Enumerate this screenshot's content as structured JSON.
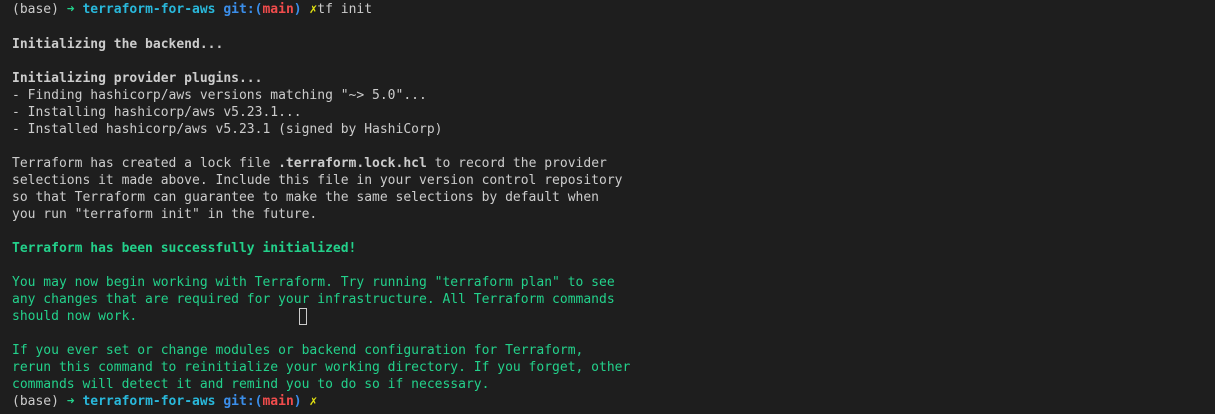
{
  "prompt1": {
    "env": "(base)",
    "arrow": "➜",
    "dir": "terraform-for-aws",
    "git_label": "git:(",
    "branch": "main",
    "git_close": ")",
    "dirty": "✗",
    "command": "tf init"
  },
  "output": {
    "backend": "Initializing the backend...",
    "plugins": "Initializing provider plugins...",
    "finding": "- Finding hashicorp/aws versions matching \"~> 5.0\"...",
    "installing": "- Installing hashicorp/aws v5.23.1...",
    "installed": "- Installed hashicorp/aws v5.23.1 (signed by HashiCorp)",
    "lock_pre": "Terraform has created a lock file ",
    "lock_file": ".terraform.lock.hcl",
    "lock_post": " to record the provider",
    "lock_2": "selections it made above. Include this file in your version control repository",
    "lock_3": "so that Terraform can guarantee to make the same selections by default when",
    "lock_4": "you run \"terraform init\" in the future.",
    "success": "Terraform has been successfully initialized!",
    "plan_1": "You may now begin working with Terraform. Try running \"terraform plan\" to see",
    "plan_2": "any changes that are required for your infrastructure. All Terraform commands",
    "plan_3": "should now work.",
    "reinit_1": "If you ever set or change modules or backend configuration for Terraform,",
    "reinit_2": "rerun this command to reinitialize your working directory. If you forget, other",
    "reinit_3": "commands will detect it and remind you to do so if necessary."
  },
  "prompt2": {
    "env": "(base)",
    "arrow": "➜",
    "dir": "terraform-for-aws",
    "git_label": "git:(",
    "branch": "main",
    "git_close": ")",
    "dirty": "✗"
  },
  "colors": {
    "background": "#1e1e1e",
    "text": "#cccccc",
    "green": "#23d18b",
    "cyan": "#29b8db",
    "blue": "#3b8eea",
    "red": "#f14c4c",
    "yellow": "#e5e510"
  }
}
